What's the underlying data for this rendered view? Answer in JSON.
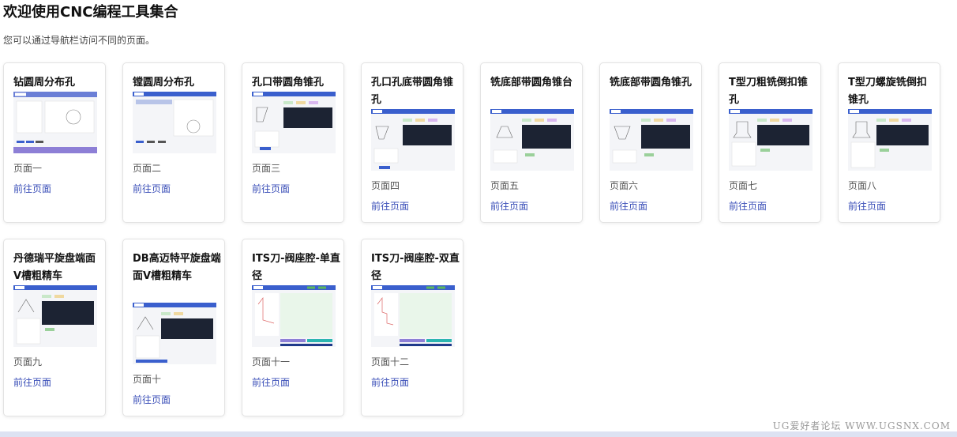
{
  "header": {
    "title": "欢迎使用CNC编程工具集合",
    "subtitle": "您可以通过导航栏访问不同的页面。"
  },
  "cards": [
    {
      "title": "钻圆周分布孔",
      "subtitle": "页面一",
      "link": "前往页面",
      "thumb": "circle"
    },
    {
      "title": "镗圆周分布孔",
      "subtitle": "页面二",
      "link": "前往页面",
      "thumb": "circle-plain"
    },
    {
      "title": "孔口带圆角锥孔",
      "subtitle": "页面三",
      "link": "前往页面",
      "thumb": "code"
    },
    {
      "title": "孔口孔底带圆角锥孔",
      "subtitle": "页面四",
      "link": "前往页面",
      "thumb": "code"
    },
    {
      "title": "铣底部带圆角锥台",
      "subtitle": "页面五",
      "link": "前往页面",
      "thumb": "code"
    },
    {
      "title": "铣底部带圆角锥孔",
      "subtitle": "页面六",
      "link": "前往页面",
      "thumb": "code"
    },
    {
      "title": "T型刀粗铣倒扣锥孔",
      "subtitle": "页面七",
      "link": "前往页面",
      "thumb": "code"
    },
    {
      "title": "T型刀螺旋铣倒扣锥孔",
      "subtitle": "页面八",
      "link": "前往页面",
      "thumb": "code"
    },
    {
      "title": "丹德瑞平旋盘端面V槽粗精车",
      "subtitle": "页面九",
      "link": "前往页面",
      "thumb": "code"
    },
    {
      "title": "DB高迈特平旋盘端面V槽粗精车",
      "subtitle": "页面十",
      "link": "前往页面",
      "thumb": "code"
    },
    {
      "title": "ITS刀-阀座腔-单直径",
      "subtitle": "页面十一",
      "link": "前往页面",
      "thumb": "its"
    },
    {
      "title": "ITS刀-阀座腔-双直径",
      "subtitle": "页面十二",
      "link": "前往页面",
      "thumb": "its"
    }
  ],
  "watermark": "UG爱好者论坛 WWW.UGSNX.COM",
  "colors": {
    "accent": "#3b4fb8",
    "thumb_header": "#3a5fcd",
    "thumb_code": "#1c2333"
  }
}
